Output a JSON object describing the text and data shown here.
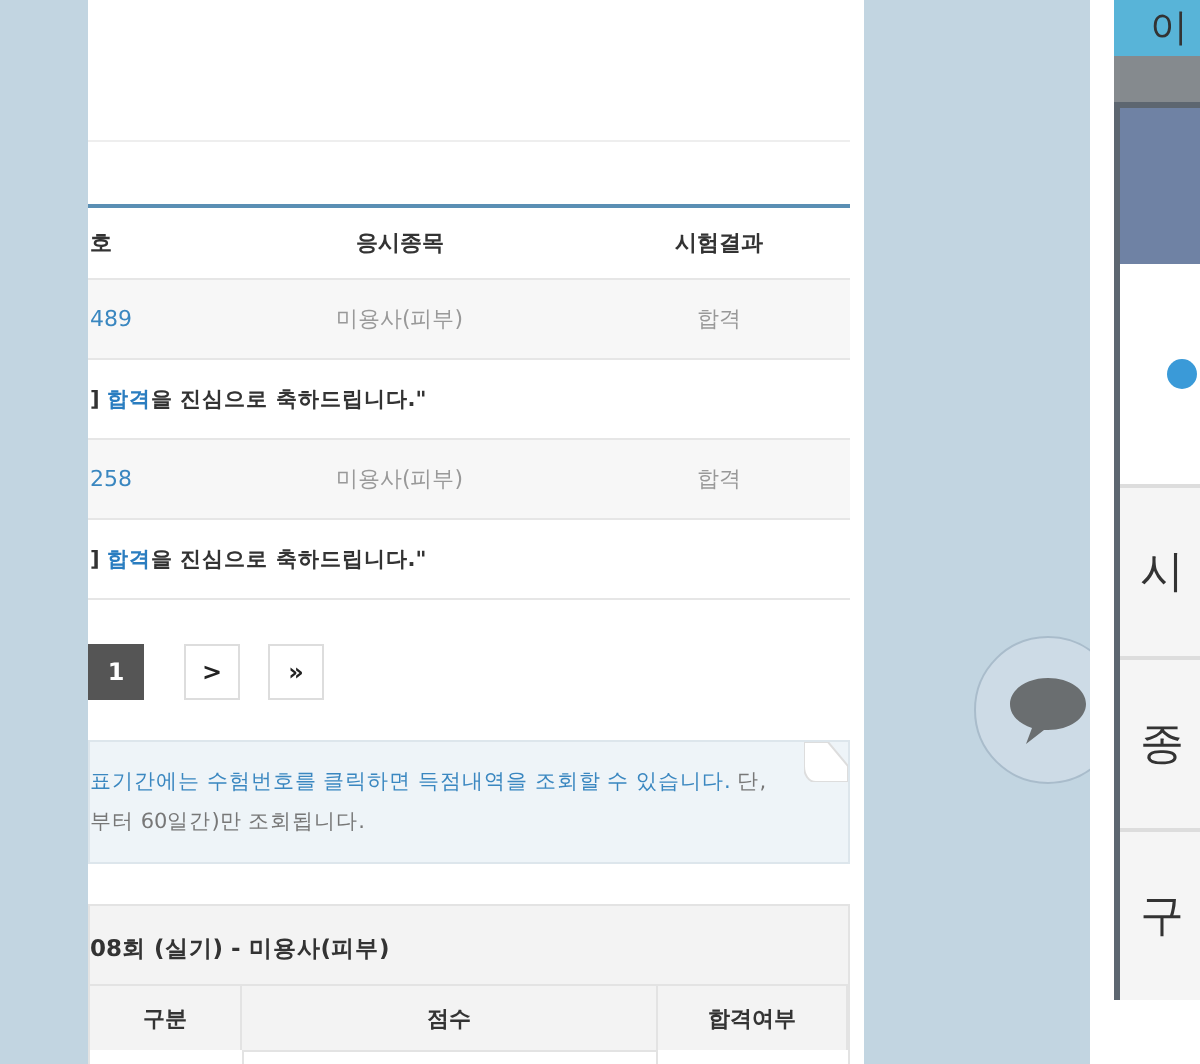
{
  "main": {
    "columns": [
      "호",
      "응시종목",
      "시험결과"
    ],
    "rows": [
      {
        "number": "489",
        "subject": "미용사(피부)",
        "result": "합격",
        "message": "] **합격**을 진심으로 축하드립니다.\""
      },
      {
        "number": "258",
        "subject": "미용사(피부)",
        "result": "합격",
        "message": "] **합격**을 진심으로 축하드립니다.\""
      }
    ],
    "pagination": [
      {
        "label": "1",
        "selected": true
      },
      {
        "label": ">",
        "selected": false
      },
      {
        "label": "»",
        "selected": false
      }
    ],
    "notice": {
      "highlight": "표기간에는 수험번호를 클릭하면 득점내역을 조회할 수 있습니다.",
      "rest": " 단,",
      "line2": "부터 60일간)만 조회됩니다."
    },
    "score_section": {
      "title": "08회 (실기) - 미용사(피부)",
      "columns": [
        "구분",
        "점수",
        "합격여부"
      ]
    }
  },
  "right_panel": {
    "title": "이",
    "rows": [
      "시",
      "종",
      "구"
    ]
  }
}
